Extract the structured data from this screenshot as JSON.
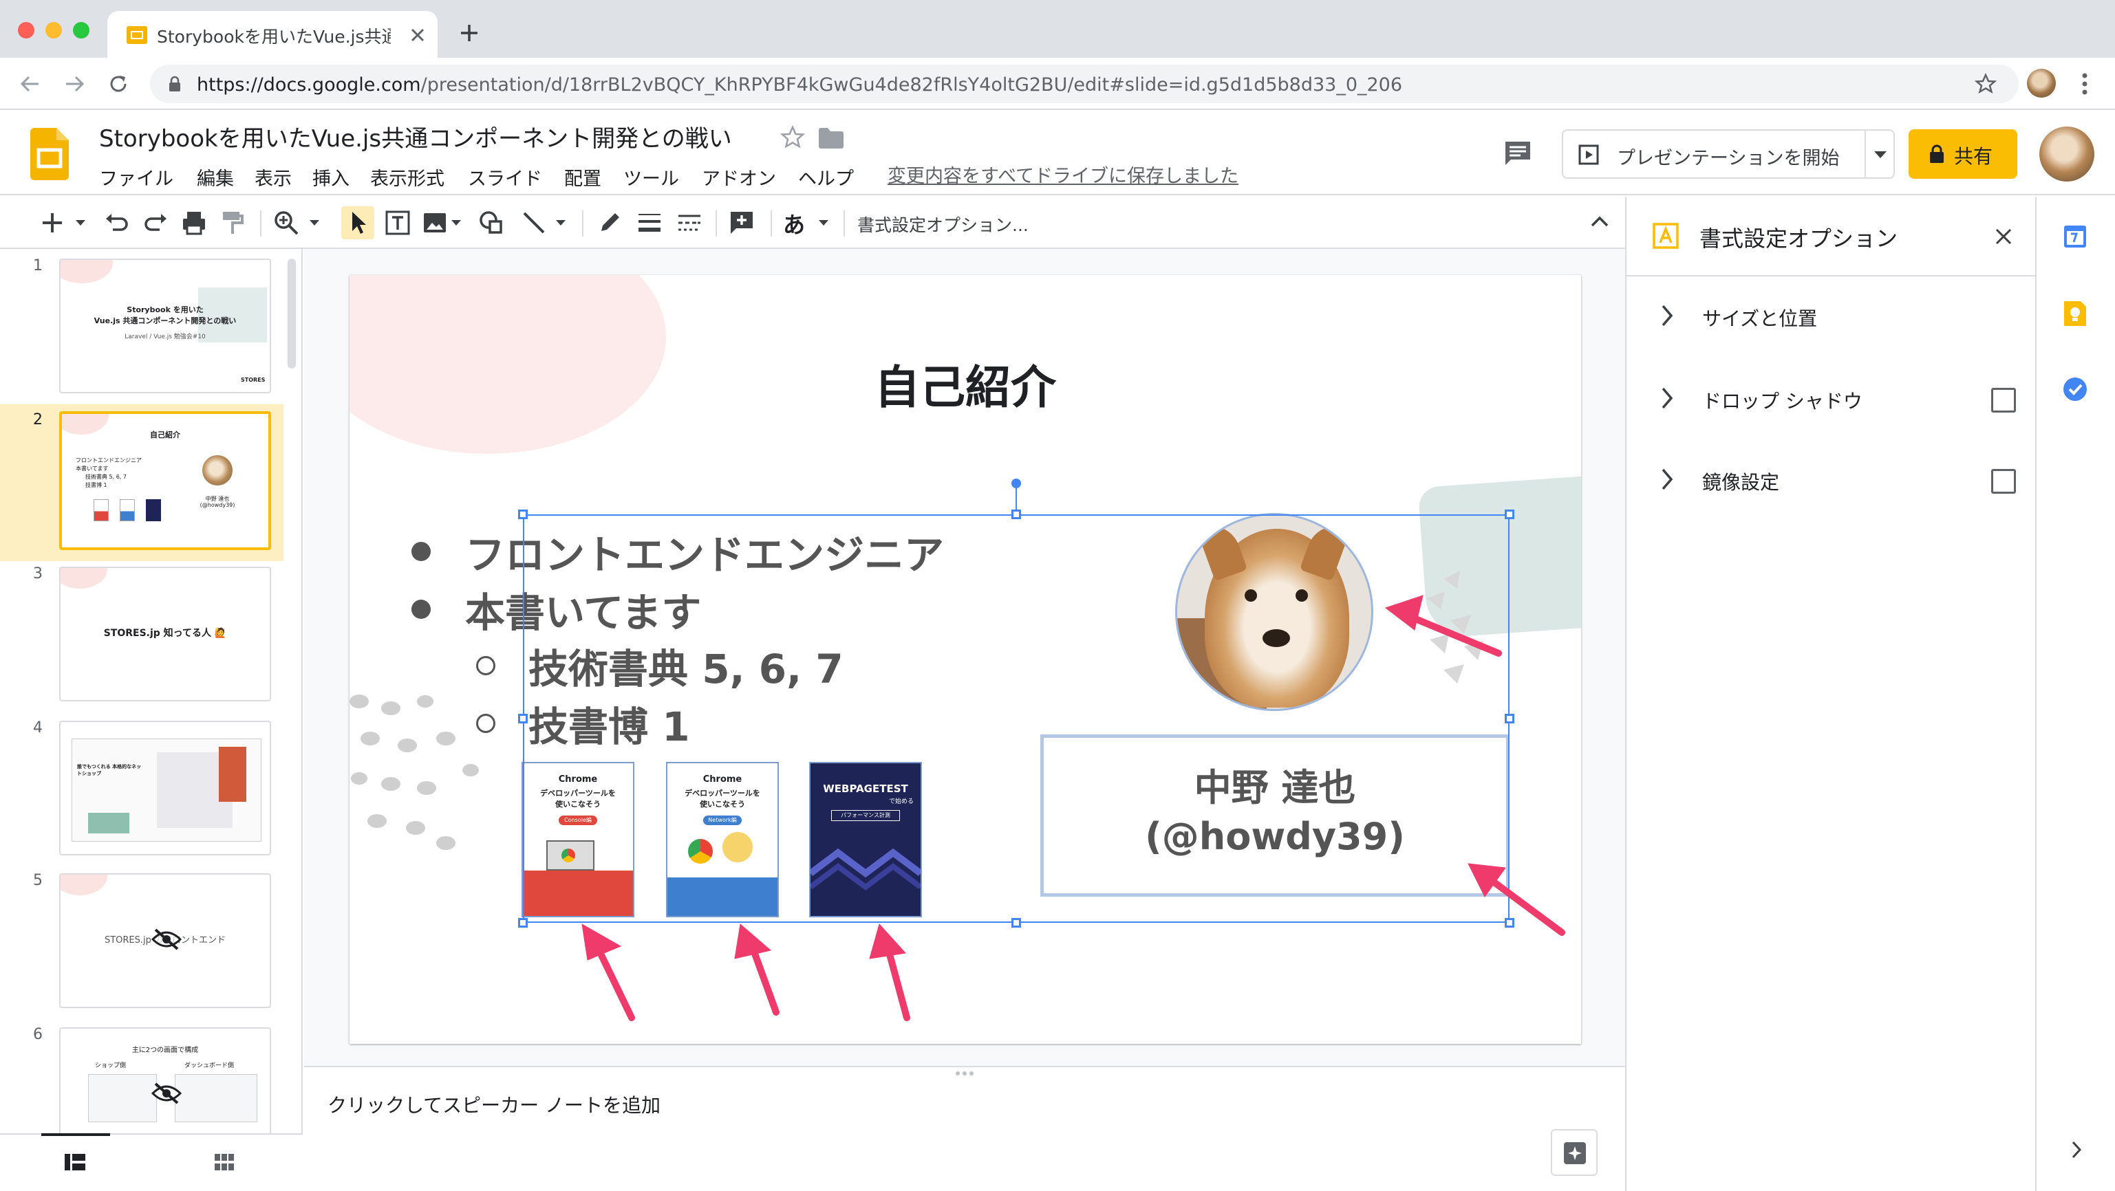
{
  "browser": {
    "tab_title": "Storybookを用いたVue.js共通コ",
    "url_host": "https://docs.google.com",
    "url_path": "/presentation/d/18rrBL2vBQCY_KhRPYBF4kGwGu4de82fRlsY4oltG2BU/edit#slide=id.g5d1d5b8d33_0_206"
  },
  "app": {
    "doc_title": "Storybookを用いたVue.js共通コンポーネント開発との戦い",
    "menus": [
      "ファイル",
      "編集",
      "表示",
      "挿入",
      "表示形式",
      "スライド",
      "配置",
      "ツール",
      "アドオン",
      "ヘルプ"
    ],
    "saved_status": "変更内容をすべてドライブに保存しました",
    "present_label": "プレゼンテーションを開始",
    "share_label": "共有"
  },
  "toolbar": {
    "format_options": "書式設定オプション...",
    "input_glyph": "あ"
  },
  "filmstrip": {
    "slides": [
      {
        "num": "1",
        "line1": "Storybook を用いた",
        "line2": "Vue.js 共通コンポーネント開発との戦い",
        "sub": "Laravel / Vue.js 勉強会#10",
        "brand": "STORES"
      },
      {
        "num": "2",
        "title": "自己紹介",
        "b1": "フロントエンドエンジニア",
        "b2": "本書いてます",
        "b3": "技術書典 5, 6, 7",
        "b4": "技書博 1",
        "name1": "中野 達也",
        "name2": "(@howdy39)"
      },
      {
        "num": "3",
        "text": "STORES.jp 知ってる人 🙋"
      },
      {
        "num": "4",
        "text": "誰でもつくれる 本格的なネットショップ"
      },
      {
        "num": "5",
        "text": "STORES.jp のフロントエンド"
      },
      {
        "num": "6",
        "title": "主に2つの画面で構成",
        "left": "ショップ側",
        "right": "ダッシュボード側"
      }
    ]
  },
  "slide": {
    "title": "自己紹介",
    "bullets": [
      {
        "level": 1,
        "text": "フロントエンドエンジニア"
      },
      {
        "level": 1,
        "text": "本書いてます"
      },
      {
        "level": 2,
        "text": "技術書典 5, 6, 7"
      },
      {
        "level": 2,
        "text": "技書博 1"
      }
    ],
    "name_line1": "中野 達也",
    "name_line2": "(@howdy39)",
    "books": [
      {
        "top": "Chrome",
        "title": "デベロッパーツールを\n使いこなそう",
        "badge": "Console編",
        "color": "#e0483e"
      },
      {
        "top": "Chrome",
        "title": "デベロッパーツールを\n使いこなそう",
        "badge": "Network編",
        "color": "#3f7fd0"
      },
      {
        "top": "WEBPAGETEST",
        "title": "で始める",
        "badge": "パフォーマンス計測",
        "color": "#1f2456"
      }
    ]
  },
  "notes": {
    "placeholder": "クリックしてスピーカー ノートを追加"
  },
  "panel": {
    "title": "書式設定オプション",
    "rows": [
      "サイズと位置",
      "ドロップ シャドウ",
      "鏡像設定"
    ]
  },
  "colors": {
    "accent": "#fbbc04",
    "selection": "#4285f4",
    "arrow": "#ef3b6b"
  }
}
